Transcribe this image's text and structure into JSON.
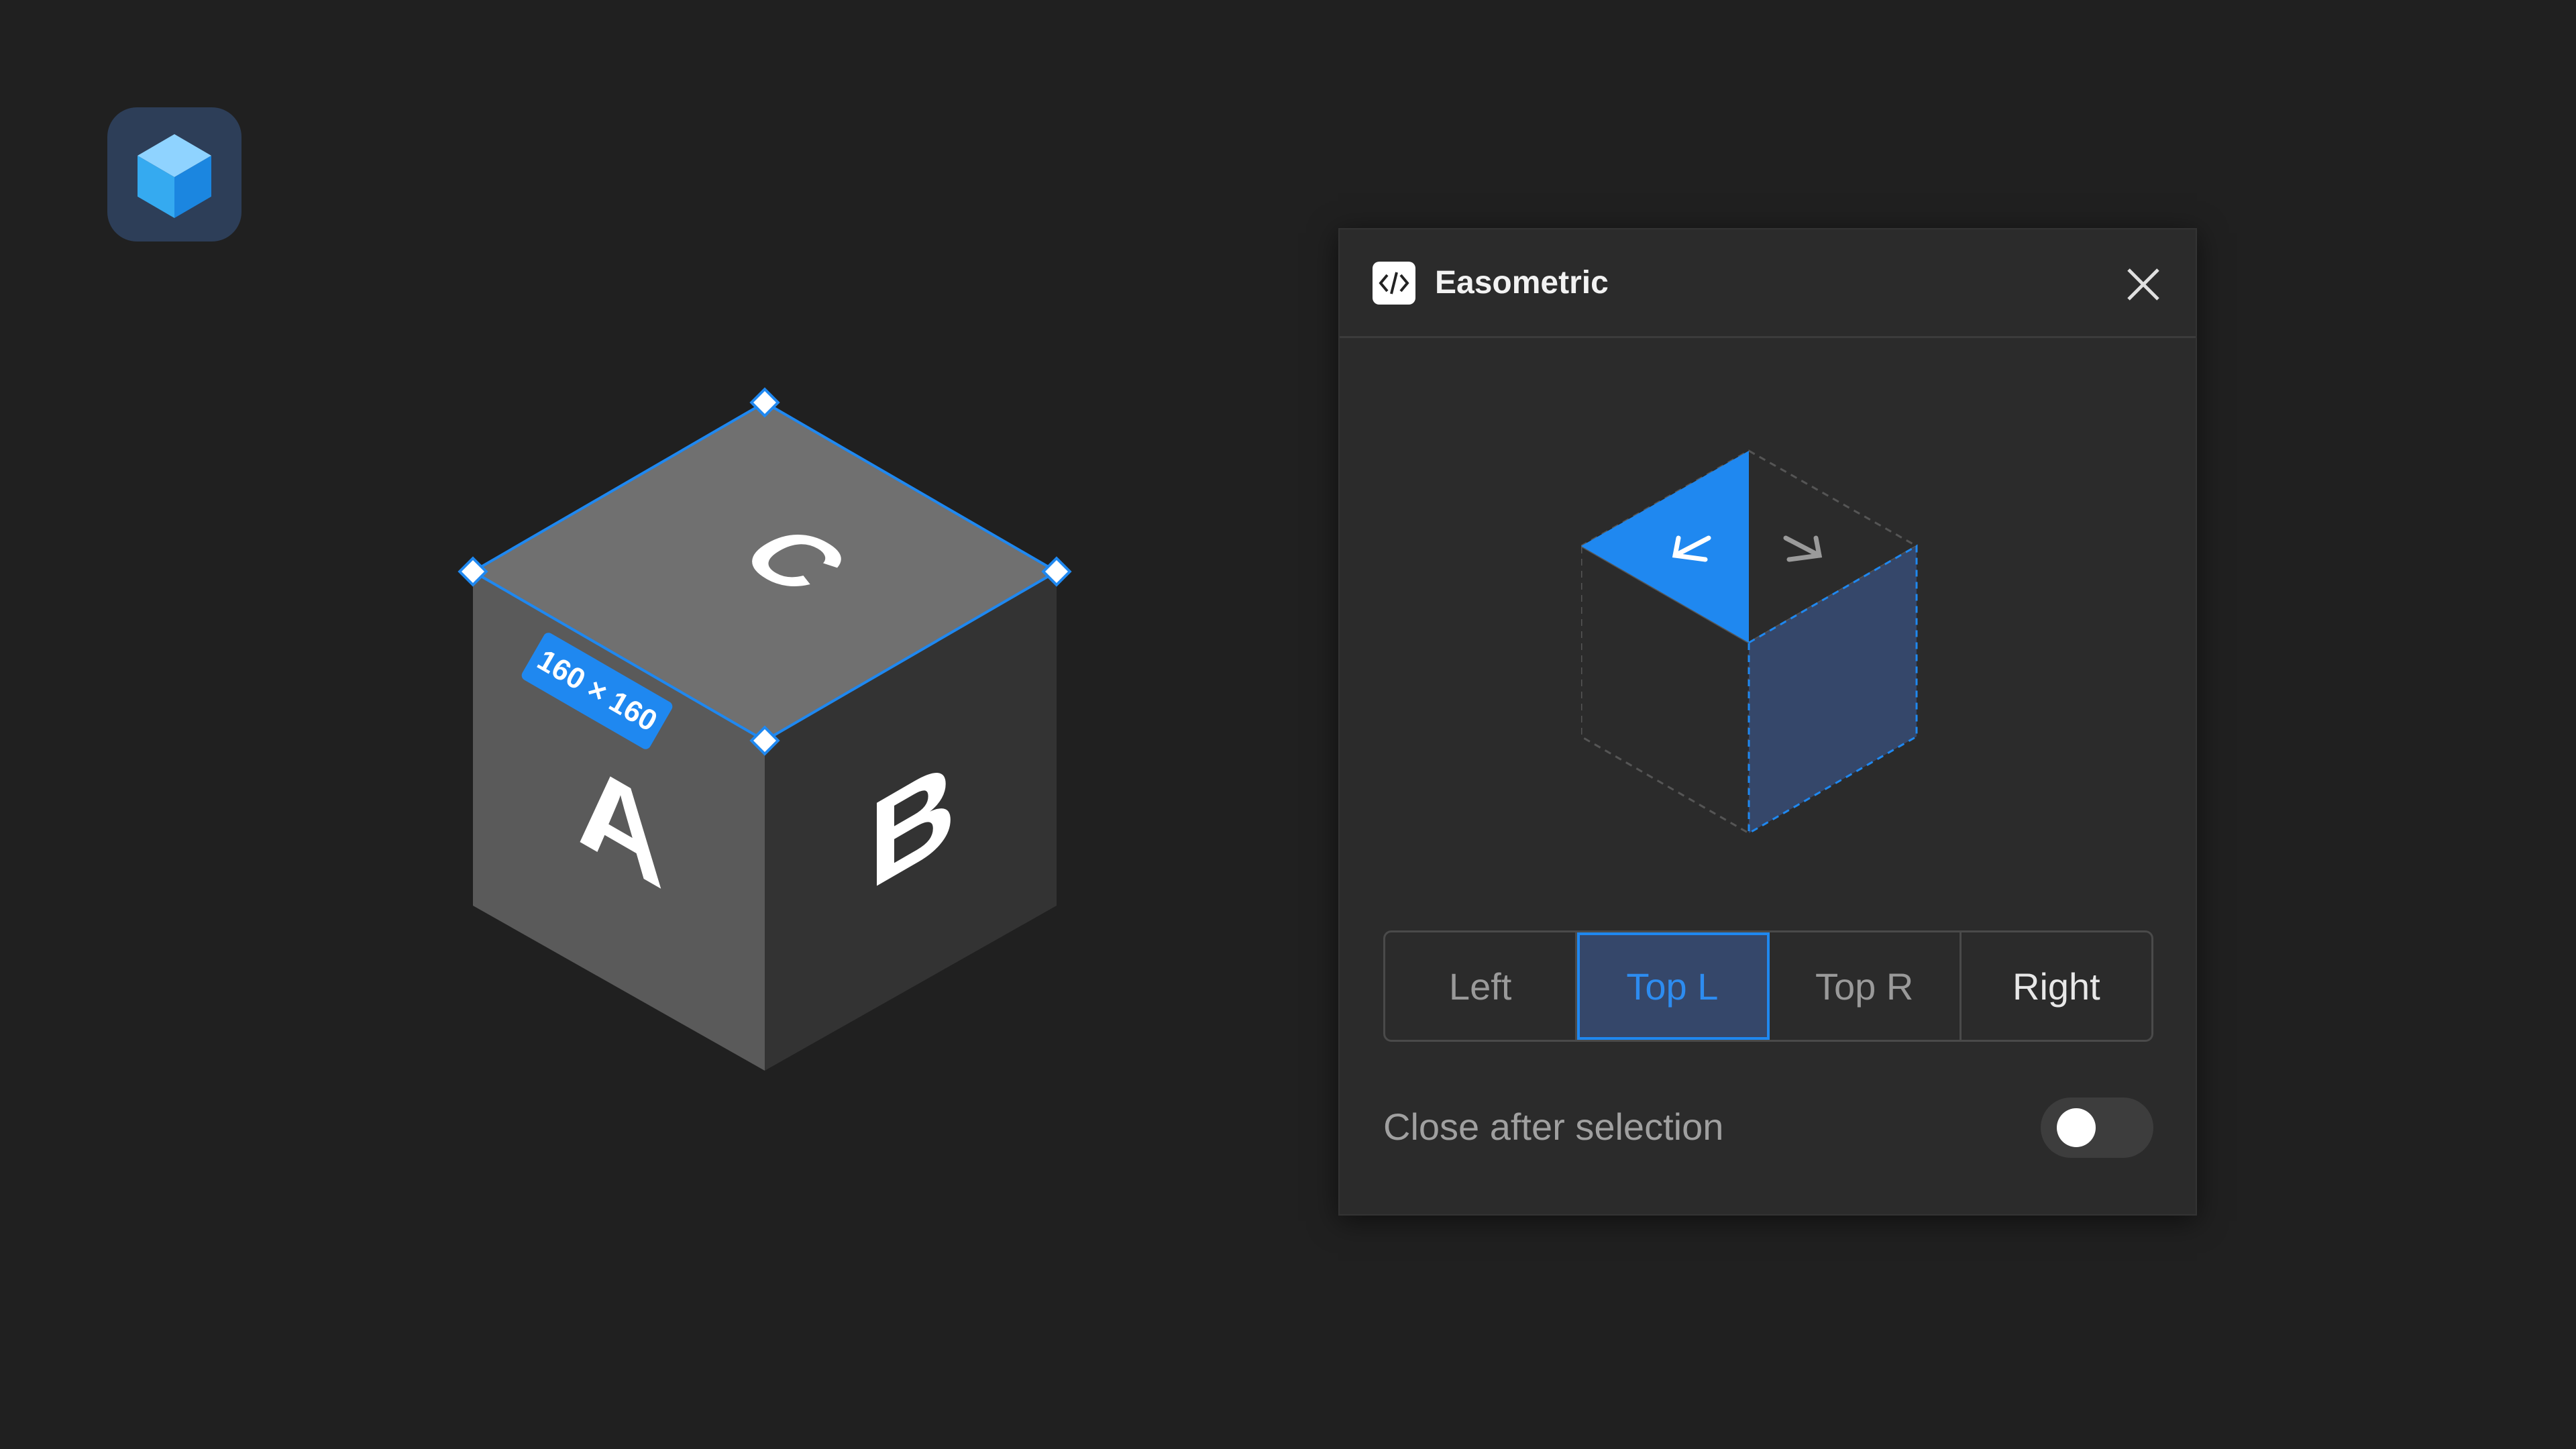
{
  "colors": {
    "background": "#202020",
    "accent": "#1f88f0",
    "face_top": "#707070",
    "face_left": "#5a5a5a",
    "face_right": "#333333",
    "panel": "#2b2b2b"
  },
  "app_icon": {
    "name": "cube-app-icon"
  },
  "cube": {
    "top_label": "C",
    "left_label": "A",
    "right_label": "B",
    "dimension_badge": "160 × 160"
  },
  "panel": {
    "title": "Easometric",
    "plugin_icon": "code-icon",
    "close_icon": "close-icon",
    "preview": {
      "active_face": "top-left",
      "arrow_left_icon": "arrow-down-left-icon",
      "arrow_right_icon": "arrow-down-right-icon"
    },
    "options": [
      {
        "label": "Left",
        "active": false
      },
      {
        "label": "Top L",
        "active": true
      },
      {
        "label": "Top R",
        "active": false
      },
      {
        "label": "Right",
        "active": false
      }
    ],
    "toggle": {
      "label": "Close after selection",
      "on": false
    }
  }
}
